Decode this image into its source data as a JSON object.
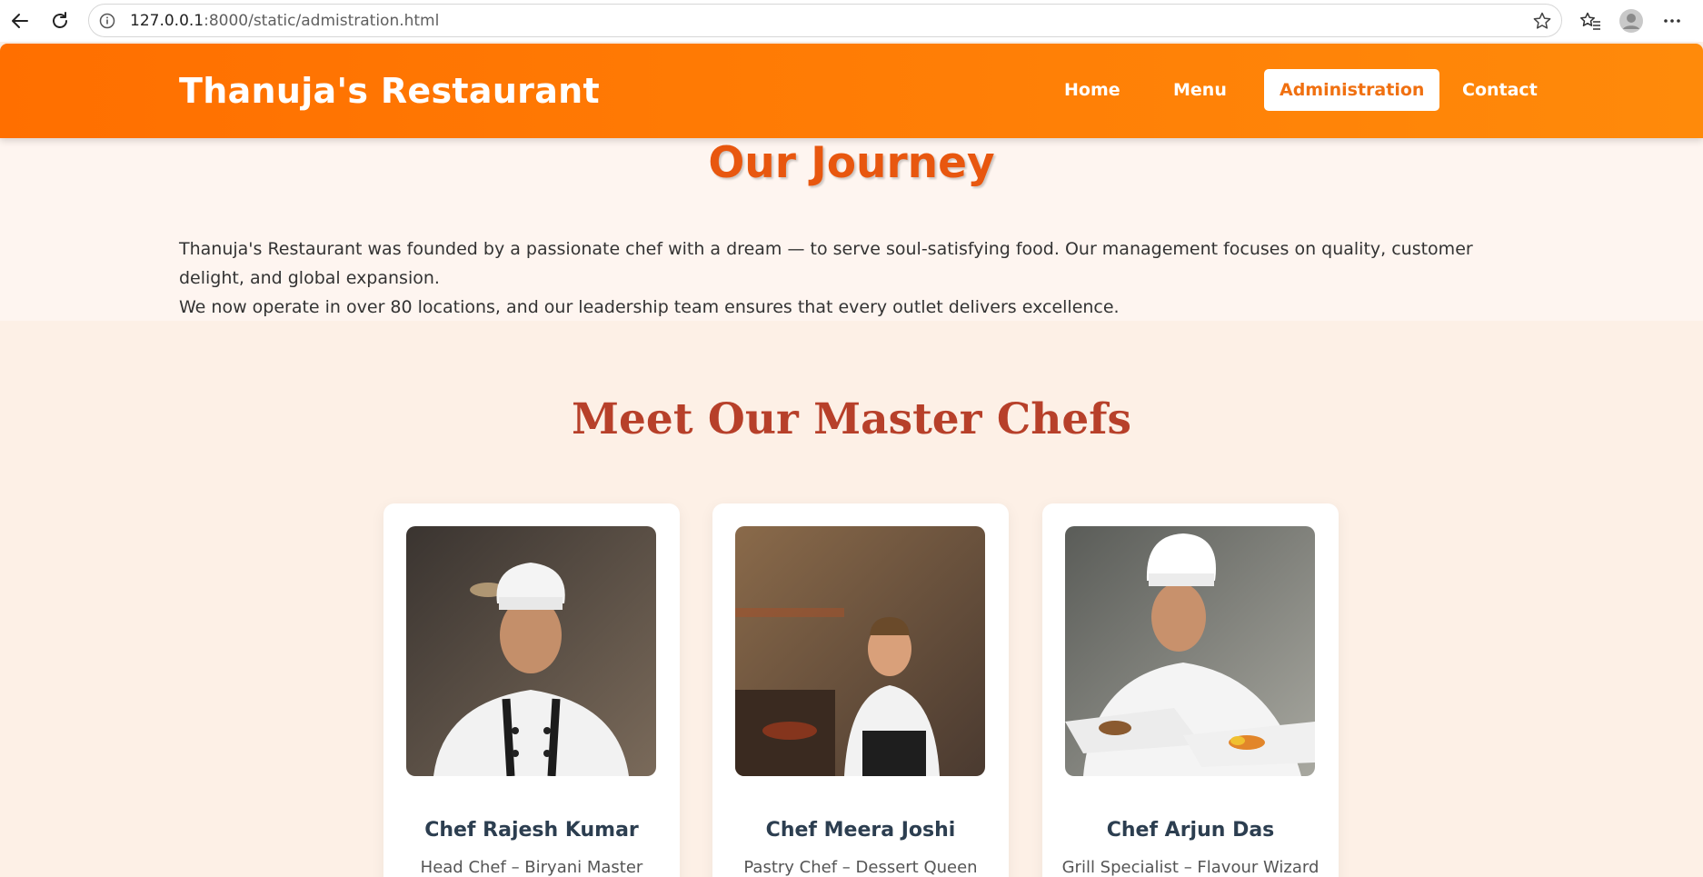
{
  "browser": {
    "url_host": "127.0.0.1",
    "url_path": ":8000/static/admistration.html"
  },
  "header": {
    "brand": "Thanuja's Restaurant",
    "nav": [
      {
        "label": "Home"
      },
      {
        "label": "Menu"
      },
      {
        "label": "Administration"
      },
      {
        "label": "Contact"
      }
    ]
  },
  "journey": {
    "title": "Our Journey",
    "paragraph1": "Thanuja's Restaurant was founded by a passionate chef with a dream — to serve soul-satisfying food. Our management focuses on quality, customer delight, and global expansion.",
    "paragraph2": "We now operate in over 80 locations, and our leadership team ensures that every outlet delivers excellence."
  },
  "chefs": {
    "title": "Meet Our Master Chefs",
    "items": [
      {
        "name": "Chef Rajesh Kumar",
        "role": "Head Chef – Biryani Master"
      },
      {
        "name": "Chef Meera Joshi",
        "role": "Pastry Chef – Dessert Queen"
      },
      {
        "name": "Chef Arjun Das",
        "role": "Grill Specialist – Flavour Wizard"
      }
    ]
  },
  "colors": {
    "header_start": "#ff6f00",
    "header_end": "#ff8a0a",
    "journey_title": "#e8570f",
    "chefs_title": "#b7402a",
    "active_nav_text": "#f07010"
  }
}
